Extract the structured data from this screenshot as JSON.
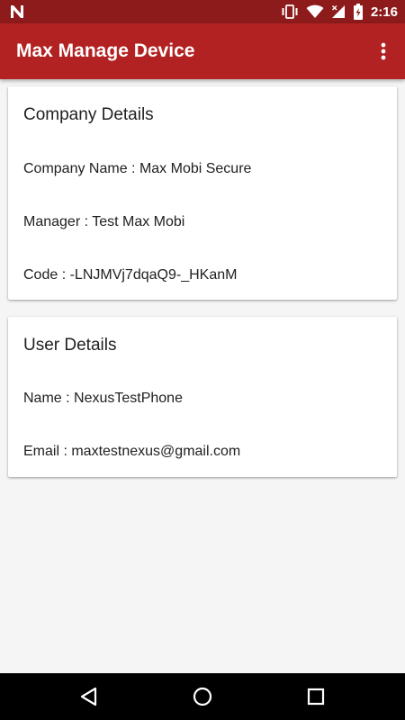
{
  "status_bar": {
    "time": "2:16",
    "icons": [
      "nougat-n-icon",
      "vibrate-icon",
      "wifi-icon",
      "signal-icon",
      "battery-charging-icon"
    ]
  },
  "app_bar": {
    "title": "Max Manage Device",
    "overflow_icon": "more-vert-icon"
  },
  "company_card": {
    "heading": "Company Details",
    "company_name": "Company Name : Max Mobi Secure",
    "manager": "Manager : Test Max Mobi",
    "code": "Code : -LNJMVj7dqaQ9-_HKanM"
  },
  "user_card": {
    "heading": "User Details",
    "name": "Name : NexusTestPhone",
    "email": "Email : maxtestnexus@gmail.com"
  },
  "nav_bar": {
    "icons": [
      "back-icon",
      "home-icon",
      "recents-icon"
    ]
  },
  "colors": {
    "status_bar": "#8e1b1b",
    "app_bar": "#b22222",
    "background": "#f5f5f5",
    "card": "#ffffff",
    "nav_bar": "#000000"
  }
}
